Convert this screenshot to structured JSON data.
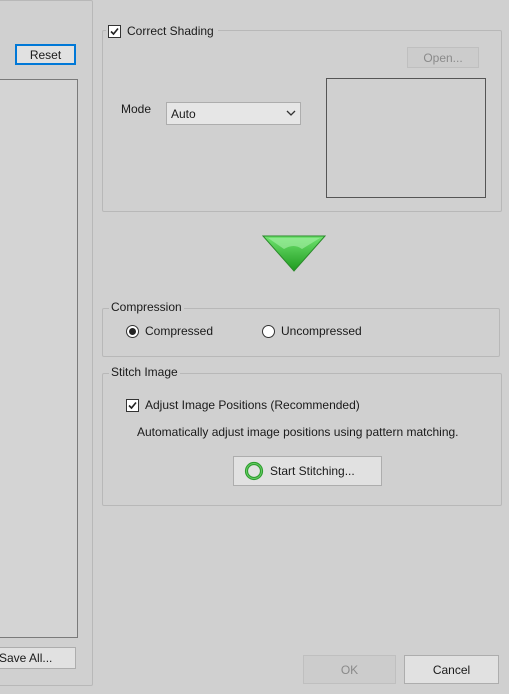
{
  "left": {
    "reset_label": "Reset",
    "save_all_label": "Save All..."
  },
  "shading": {
    "checkbox_label": "Correct Shading",
    "checked": true,
    "open_label": "Open...",
    "mode_label": "Mode",
    "mode_value": "Auto"
  },
  "compression": {
    "title": "Compression",
    "options": [
      {
        "label": "Compressed",
        "selected": true
      },
      {
        "label": "Uncompressed",
        "selected": false
      }
    ]
  },
  "stitch": {
    "title": "Stitch Image",
    "adjust_label": "Adjust Image Positions (Recommended)",
    "adjust_checked": true,
    "description": "Automatically adjust image positions using pattern matching.",
    "start_label": "Start Stitching..."
  },
  "footer": {
    "ok_label": "OK",
    "cancel_label": "Cancel"
  },
  "colors": {
    "arrow_green": "#3fbf3f",
    "stitch_icon_green": "#2e9e2e",
    "default_button_border": "#0078d7"
  }
}
